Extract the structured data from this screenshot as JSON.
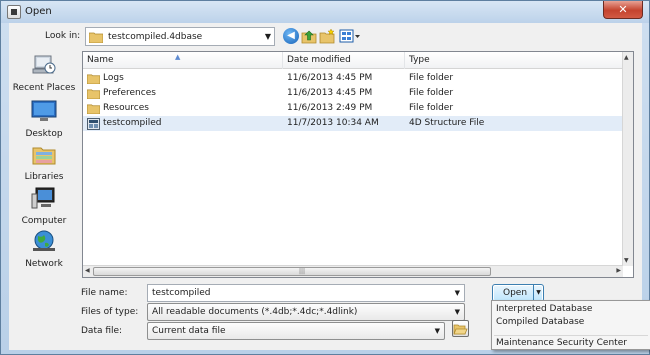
{
  "window": {
    "title": "Open",
    "close_glyph": "✕"
  },
  "toolbar": {
    "look_in_label": "Look in:",
    "look_in_value": "testcompiled.4dbase",
    "icons": [
      "back-icon",
      "up-folder-icon",
      "new-folder-icon",
      "views-menu-icon"
    ]
  },
  "places": [
    {
      "label": "Recent Places",
      "icon": "recent-places-icon"
    },
    {
      "label": "Desktop",
      "icon": "desktop-icon"
    },
    {
      "label": "Libraries",
      "icon": "libraries-icon"
    },
    {
      "label": "Computer",
      "icon": "computer-icon"
    },
    {
      "label": "Network",
      "icon": "network-icon"
    }
  ],
  "filelist": {
    "columns": [
      "Name",
      "Date modified",
      "Type"
    ],
    "rows": [
      {
        "name": "Logs",
        "date": "11/6/2013 4:45 PM",
        "type": "File folder",
        "icon": "folder-icon"
      },
      {
        "name": "Preferences",
        "date": "11/6/2013 4:45 PM",
        "type": "File folder",
        "icon": "folder-icon"
      },
      {
        "name": "Resources",
        "date": "11/6/2013 2:49 PM",
        "type": "File folder",
        "icon": "folder-icon"
      },
      {
        "name": "testcompiled",
        "date": "11/7/2013 10:34 AM",
        "type": "4D Structure File",
        "icon": "4d-structure-file-icon",
        "selected": true
      }
    ]
  },
  "form": {
    "file_name_label": "File name:",
    "file_name_value": "testcompiled",
    "files_of_type_label": "Files of type:",
    "files_of_type_value": "All readable documents (*.4db;*.4dc;*.4dlink)",
    "data_file_label": "Data file:",
    "data_file_value": "Current data file"
  },
  "open_button": {
    "label": "Open"
  },
  "open_menu": {
    "items": [
      "Interpreted Database",
      "Compiled Database",
      "Maintenance  Security Center"
    ]
  },
  "colors": {
    "selection": "#e2ecf8",
    "folder": "#e8c46a",
    "accent": "#3c7fb1"
  }
}
